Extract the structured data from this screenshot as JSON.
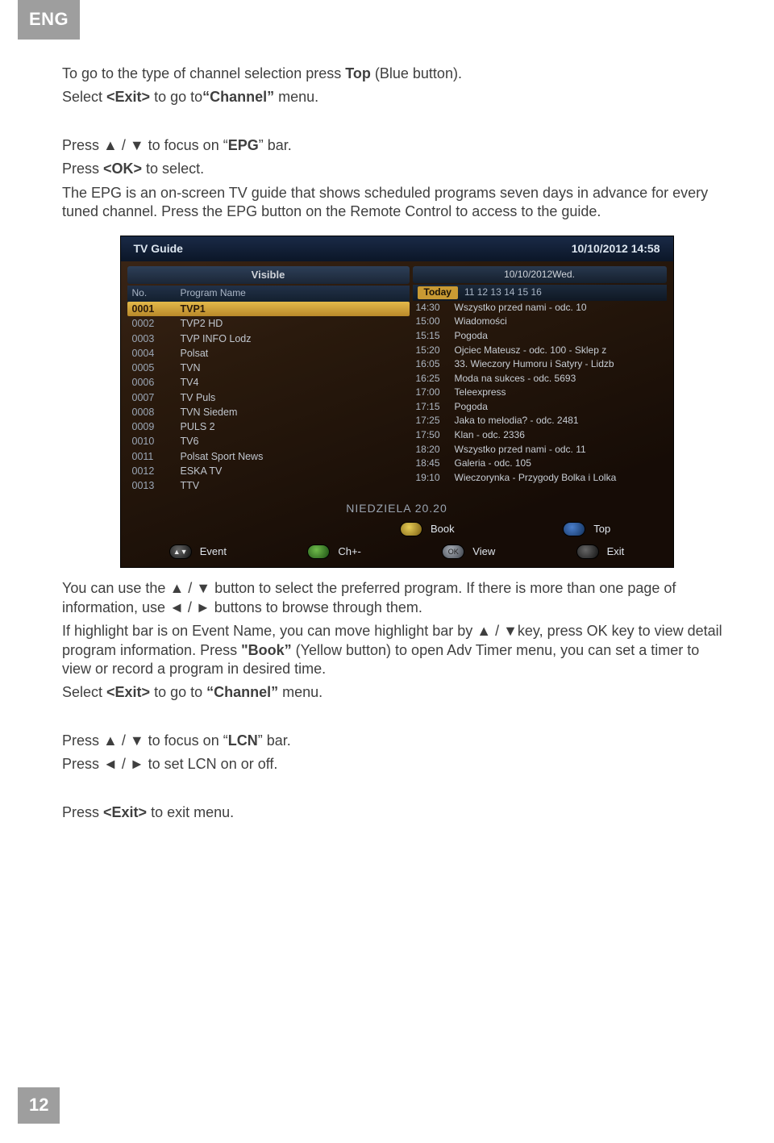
{
  "lang": "ENG",
  "page_number": "12",
  "text": {
    "p1a": "To go to the type of channel selection press ",
    "p1b": "Top",
    "p1c": " (Blue button).",
    "p2a": "Select ",
    "p2b": "<Exit>",
    "p2c": " to go to",
    "p2d": "“Channel”",
    "p2e": " menu.",
    "p3a": "Press ▲ / ▼ to focus on “",
    "p3b": "EPG",
    "p3c": "” bar.",
    "p4a": "Press ",
    "p4b": "<OK>",
    "p4c": " to select.",
    "p5": "The EPG is an on-screen TV guide that shows scheduled programs seven days in advance for every tuned channel. Press the EPG button on the Remote Control to access to the guide.",
    "p6": "You can use the ▲ / ▼ button to select the preferred program. If there is more than one page of information, use ◄ / ► buttons to browse through them.",
    "p7a": "If highlight bar is on Event Name, you can move highlight bar by ▲ / ▼key, press OK key to view detail program information. Press ",
    "p7b": "\"Book”",
    "p7c": " (Yellow button) to open Adv Timer menu, you can set a timer to view or record a program in desired time.",
    "p8a": "Select ",
    "p8b": "<Exit>",
    "p8c": " to go to ",
    "p8d": "“Channel”",
    "p8e": " menu.",
    "p9a": "Press ▲ / ▼ to focus on “",
    "p9b": "LCN",
    "p9c": "” bar.",
    "p10": "Press ◄ / ► to set LCN on or off.",
    "p11a": "Press ",
    "p11b": "<Exit>",
    "p11c": " to exit menu."
  },
  "tv": {
    "title": "TV Guide",
    "datetime": "10/10/2012 14:58",
    "visible": "Visible",
    "col_no": "No.",
    "col_name": "Program Name",
    "channels": [
      {
        "no": "0001",
        "name": "TVP1",
        "selected": true
      },
      {
        "no": "0002",
        "name": "TVP2 HD"
      },
      {
        "no": "0003",
        "name": "TVP INFO Lodz"
      },
      {
        "no": "0004",
        "name": "Polsat"
      },
      {
        "no": "0005",
        "name": "TVN"
      },
      {
        "no": "0006",
        "name": "TV4"
      },
      {
        "no": "0007",
        "name": "TV Puls"
      },
      {
        "no": "0008",
        "name": "TVN Siedem"
      },
      {
        "no": "0009",
        "name": "PULS 2"
      },
      {
        "no": "0010",
        "name": "TV6"
      },
      {
        "no": "0011",
        "name": "Polsat Sport News"
      },
      {
        "no": "0012",
        "name": "ESKA TV"
      },
      {
        "no": "0013",
        "name": "TTV"
      }
    ],
    "date_label": "10/10/2012Wed.",
    "today": "Today",
    "days": [
      "11",
      "12",
      "13",
      "14",
      "15",
      "16"
    ],
    "events": [
      {
        "t": "14:30",
        "e": "Wszystko przed nami - odc. 10"
      },
      {
        "t": "15:00",
        "e": "Wiadomości"
      },
      {
        "t": "15:15",
        "e": "Pogoda"
      },
      {
        "t": "15:20",
        "e": "Ojciec Mateusz - odc. 100 - Sklep z"
      },
      {
        "t": "16:05",
        "e": "33. Wieczory Humoru i Satyry - Lidzb"
      },
      {
        "t": "16:25",
        "e": "Moda na sukces - odc. 5693"
      },
      {
        "t": "17:00",
        "e": "Teleexpress"
      },
      {
        "t": "17:15",
        "e": "Pogoda"
      },
      {
        "t": "17:25",
        "e": "Jaka to melodia? - odc. 2481"
      },
      {
        "t": "17:50",
        "e": "Klan - odc. 2336"
      },
      {
        "t": "18:20",
        "e": "Wszystko przed nami - odc. 11"
      },
      {
        "t": "18:45",
        "e": "Galeria - odc. 105"
      },
      {
        "t": "19:10",
        "e": "Wieczorynka - Przygody Bolka i Lolka"
      }
    ],
    "niedz": "NIEDZIELA 20.20",
    "buttons": {
      "event": "Event",
      "ch": "Ch+-",
      "book": "Book",
      "view": "View",
      "top": "Top",
      "exit": "Exit",
      "ok": "OK",
      "arrows": "▲▼"
    }
  }
}
